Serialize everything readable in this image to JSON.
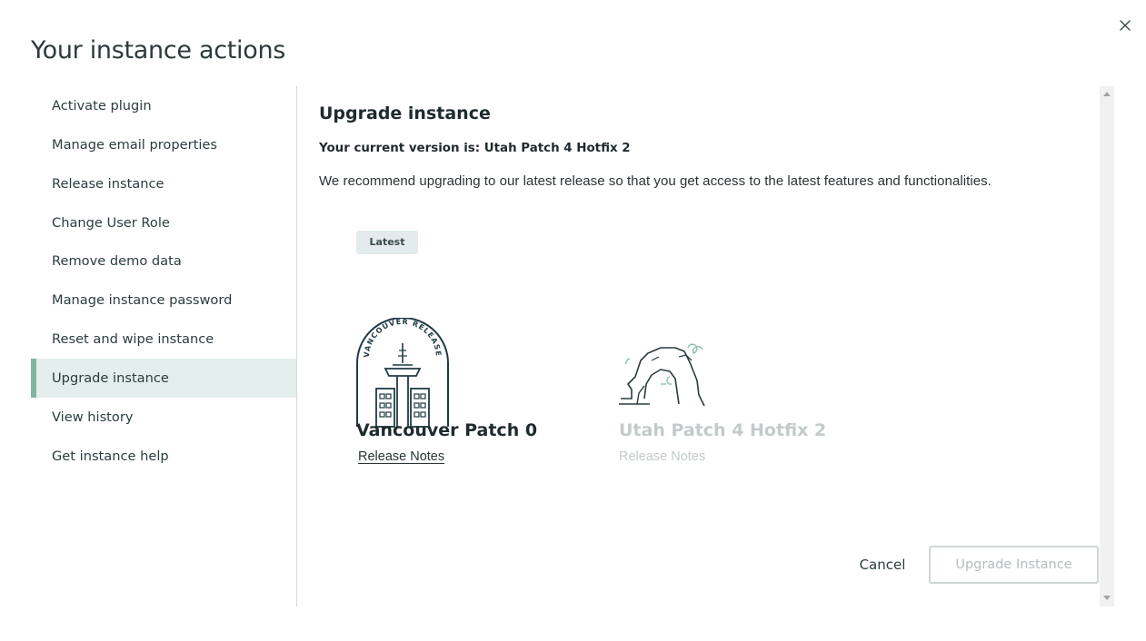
{
  "modal": {
    "title": "Your instance actions",
    "close_icon": "close-icon"
  },
  "sidebar": {
    "items": [
      {
        "label": "Activate plugin",
        "active": false
      },
      {
        "label": "Manage email properties",
        "active": false
      },
      {
        "label": "Release instance",
        "active": false
      },
      {
        "label": "Change User Role",
        "active": false
      },
      {
        "label": "Remove demo data",
        "active": false
      },
      {
        "label": "Manage instance password",
        "active": false
      },
      {
        "label": "Reset and wipe instance",
        "active": false
      },
      {
        "label": "Upgrade instance",
        "active": true
      },
      {
        "label": "View history",
        "active": false
      },
      {
        "label": "Get instance help",
        "active": false
      }
    ]
  },
  "main": {
    "title": "Upgrade instance",
    "current_version": "Your current version is: Utah Patch 4 Hotfix 2",
    "recommendation": "We recommend upgrading to our latest release so that you get access to the latest features and functionalities.",
    "latest_badge": "Latest",
    "releases": [
      {
        "name": "Vancouver Patch 0",
        "notes_label": "Release Notes",
        "art_icon": "vancouver-release-icon",
        "art_text": "VANCOUVER RELEASE",
        "enabled": true
      },
      {
        "name": "Utah Patch 4 Hotfix 2",
        "notes_label": "Release Notes",
        "art_icon": "utah-arch-icon",
        "enabled": false
      }
    ],
    "cancel_label": "Cancel",
    "upgrade_label": "Upgrade Instance"
  },
  "colors": {
    "accent": "#81b5a1",
    "active_bg": "#e4eeec",
    "badge_bg": "#e3ebec",
    "disabled_text": "#c4cacb"
  }
}
